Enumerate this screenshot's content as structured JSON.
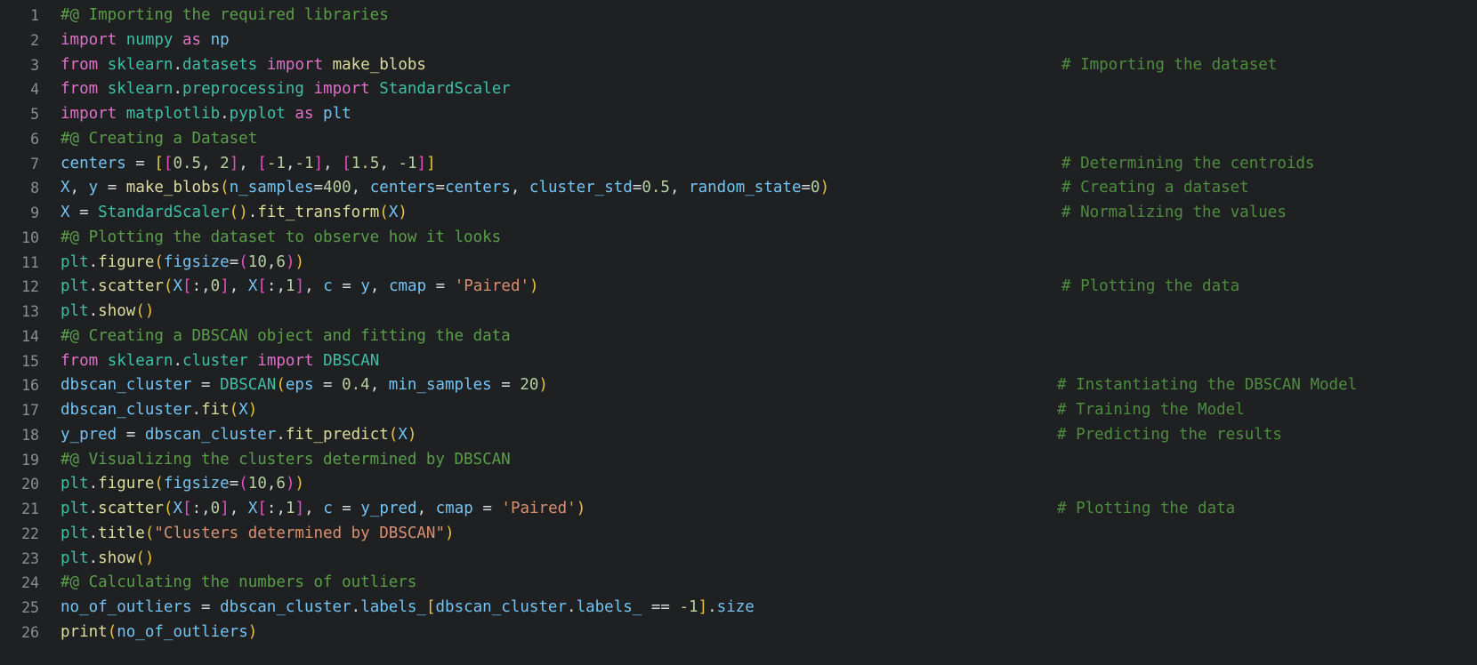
{
  "editor": {
    "language": "python",
    "theme": "dark",
    "background_color": "#1f2022",
    "gutter_color": "#8b8f93",
    "total_lines": 26,
    "first_visible_line": 1,
    "last_visible_line": 26
  },
  "colors": {
    "comment": "#5a9e4a",
    "keyword": "#e06fc8",
    "module": "#3fbfa8",
    "function": "#dcdc9d",
    "variable": "#73c3f3",
    "number": "#b6cfa0",
    "string": "#d79070",
    "operator": "#d8d8d8",
    "bracket_1": "#e6c341",
    "bracket_2": "#e44fc0",
    "bracket_3": "#35b7f0"
  },
  "line_numbers": [
    "1",
    "2",
    "3",
    "4",
    "5",
    "6",
    "7",
    "8",
    "9",
    "10",
    "11",
    "12",
    "13",
    "14",
    "15",
    "16",
    "17",
    "18",
    "19",
    "20",
    "21",
    "22",
    "23",
    "24",
    "25",
    "26"
  ],
  "lines": [
    {
      "n": "1",
      "text": "#@ Importing the required libraries",
      "trailing_comment": ""
    },
    {
      "n": "2",
      "text": "import numpy as np",
      "trailing_comment": ""
    },
    {
      "n": "3",
      "text": "from sklearn.datasets import make_blobs",
      "trailing_comment": "# Importing the dataset"
    },
    {
      "n": "4",
      "text": "from sklearn.preprocessing import StandardScaler",
      "trailing_comment": ""
    },
    {
      "n": "5",
      "text": "import matplotlib.pyplot as plt",
      "trailing_comment": ""
    },
    {
      "n": "6",
      "text": "#@ Creating a Dataset",
      "trailing_comment": ""
    },
    {
      "n": "7",
      "text": "centers = [[0.5, 2], [-1,-1], [1.5, -1]]",
      "trailing_comment": "# Determining the centroids"
    },
    {
      "n": "8",
      "text": "X, y = make_blobs(n_samples=400, centers=centers, cluster_std=0.5, random_state=0)",
      "trailing_comment": "# Creating a dataset"
    },
    {
      "n": "9",
      "text": "X = StandardScaler().fit_transform(X)",
      "trailing_comment": "# Normalizing the values"
    },
    {
      "n": "10",
      "text": "#@ Plotting the dataset to observe how it looks",
      "trailing_comment": ""
    },
    {
      "n": "11",
      "text": "plt.figure(figsize=(10,6))",
      "trailing_comment": ""
    },
    {
      "n": "12",
      "text": "plt.scatter(X[:,0], X[:,1], c = y, cmap = 'Paired')",
      "trailing_comment": "# Plotting the data"
    },
    {
      "n": "13",
      "text": "plt.show()",
      "trailing_comment": ""
    },
    {
      "n": "14",
      "text": "#@ Creating a DBSCAN object and fitting the data",
      "trailing_comment": ""
    },
    {
      "n": "15",
      "text": "from sklearn.cluster import DBSCAN",
      "trailing_comment": ""
    },
    {
      "n": "16",
      "text": "dbscan_cluster = DBSCAN(eps = 0.4, min_samples = 20)",
      "trailing_comment": "# Instantiating the DBSCAN Model"
    },
    {
      "n": "17",
      "text": "dbscan_cluster.fit(X)",
      "trailing_comment": "# Training the Model"
    },
    {
      "n": "18",
      "text": "y_pred = dbscan_cluster.fit_predict(X)",
      "trailing_comment": "# Predicting the results"
    },
    {
      "n": "19",
      "text": "#@ Visualizing the clusters determined by DBSCAN",
      "trailing_comment": ""
    },
    {
      "n": "20",
      "text": "plt.figure(figsize=(10,6))",
      "trailing_comment": ""
    },
    {
      "n": "21",
      "text": "plt.scatter(X[:,0], X[:,1], c = y_pred, cmap = 'Paired')",
      "trailing_comment": "# Plotting the data"
    },
    {
      "n": "22",
      "text": "plt.title(\"Clusters determined by DBSCAN\")",
      "trailing_comment": ""
    },
    {
      "n": "23",
      "text": "plt.show()",
      "trailing_comment": ""
    },
    {
      "n": "24",
      "text": "#@ Calculating the numbers of outliers",
      "trailing_comment": ""
    },
    {
      "n": "25",
      "text": "no_of_outliers = dbscan_cluster.labels_[dbscan_cluster.labels_ == -1].size",
      "trailing_comment": ""
    },
    {
      "n": "26",
      "text": "print(no_of_outliers)",
      "trailing_comment": ""
    }
  ],
  "tokens": {
    "l1": [
      [
        "#@ Importing the required libraries",
        "cmt"
      ]
    ],
    "l2": [
      [
        "import ",
        "kw"
      ],
      [
        "numpy",
        "mod"
      ],
      [
        " as ",
        "kw"
      ],
      [
        "np",
        "var"
      ]
    ],
    "l3": [
      [
        "from ",
        "kw"
      ],
      [
        "sklearn",
        "mod"
      ],
      [
        ".",
        "op"
      ],
      [
        "datasets",
        "mod"
      ],
      [
        " import ",
        "kw"
      ],
      [
        "make_blobs",
        "fn"
      ]
    ],
    "l4": [
      [
        "from ",
        "kw"
      ],
      [
        "sklearn",
        "mod"
      ],
      [
        ".",
        "op"
      ],
      [
        "preprocessing",
        "mod"
      ],
      [
        " import ",
        "kw"
      ],
      [
        "StandardScaler",
        "mod"
      ]
    ],
    "l5": [
      [
        "import ",
        "kw"
      ],
      [
        "matplotlib",
        "mod"
      ],
      [
        ".",
        "op"
      ],
      [
        "pyplot",
        "mod"
      ],
      [
        " as ",
        "kw"
      ],
      [
        "plt",
        "var"
      ]
    ],
    "l6": [
      [
        "#@ Creating a Dataset",
        "cmt"
      ]
    ],
    "l7": [
      [
        "centers",
        "var"
      ],
      [
        " = ",
        "op"
      ],
      [
        "[",
        "b1"
      ],
      [
        "[",
        "b2"
      ],
      [
        "0.5",
        "num"
      ],
      [
        ", ",
        "op"
      ],
      [
        "2",
        "num"
      ],
      [
        "]",
        "b2"
      ],
      [
        ", ",
        "op"
      ],
      [
        "[",
        "b2"
      ],
      [
        "-1",
        "num"
      ],
      [
        ",",
        "op"
      ],
      [
        "-1",
        "num"
      ],
      [
        "]",
        "b2"
      ],
      [
        ", ",
        "op"
      ],
      [
        "[",
        "b2"
      ],
      [
        "1.5",
        "num"
      ],
      [
        ", ",
        "op"
      ],
      [
        "-1",
        "num"
      ],
      [
        "]",
        "b2"
      ],
      [
        "]",
        "b1"
      ]
    ],
    "l8": [
      [
        "X",
        "var"
      ],
      [
        ", ",
        "op"
      ],
      [
        "y",
        "var"
      ],
      [
        " = ",
        "op"
      ],
      [
        "make_blobs",
        "fn"
      ],
      [
        "(",
        "b1"
      ],
      [
        "n_samples",
        "var"
      ],
      [
        "=",
        "op"
      ],
      [
        "400",
        "num"
      ],
      [
        ", ",
        "op"
      ],
      [
        "centers",
        "var"
      ],
      [
        "=",
        "op"
      ],
      [
        "centers",
        "var"
      ],
      [
        ", ",
        "op"
      ],
      [
        "cluster_std",
        "var"
      ],
      [
        "=",
        "op"
      ],
      [
        "0.5",
        "num"
      ],
      [
        ", ",
        "op"
      ],
      [
        "random_state",
        "var"
      ],
      [
        "=",
        "op"
      ],
      [
        "0",
        "num"
      ],
      [
        ")",
        "b1"
      ]
    ],
    "l9": [
      [
        "X",
        "var"
      ],
      [
        " = ",
        "op"
      ],
      [
        "StandardScaler",
        "mod"
      ],
      [
        "(",
        "b1"
      ],
      [
        ")",
        "b1"
      ],
      [
        ".",
        "op"
      ],
      [
        "fit_transform",
        "fn"
      ],
      [
        "(",
        "b1"
      ],
      [
        "X",
        "var"
      ],
      [
        ")",
        "b1"
      ]
    ],
    "l10": [
      [
        "#@ Plotting the dataset to observe how it looks",
        "cmt"
      ]
    ],
    "l11": [
      [
        "plt",
        "plt"
      ],
      [
        ".",
        "op"
      ],
      [
        "figure",
        "fn"
      ],
      [
        "(",
        "b1"
      ],
      [
        "figsize",
        "var"
      ],
      [
        "=",
        "op"
      ],
      [
        "(",
        "b2"
      ],
      [
        "10",
        "num"
      ],
      [
        ",",
        "op"
      ],
      [
        "6",
        "num"
      ],
      [
        ")",
        "b2"
      ],
      [
        ")",
        "b1"
      ]
    ],
    "l12": [
      [
        "plt",
        "plt"
      ],
      [
        ".",
        "op"
      ],
      [
        "scatter",
        "fn"
      ],
      [
        "(",
        "b1"
      ],
      [
        "X",
        "var"
      ],
      [
        "[",
        "b2"
      ],
      [
        ":",
        "op"
      ],
      [
        ",",
        "op"
      ],
      [
        "0",
        "num"
      ],
      [
        "]",
        "b2"
      ],
      [
        ", ",
        "op"
      ],
      [
        "X",
        "var"
      ],
      [
        "[",
        "b2"
      ],
      [
        ":",
        "op"
      ],
      [
        ",",
        "op"
      ],
      [
        "1",
        "num"
      ],
      [
        "]",
        "b2"
      ],
      [
        ", ",
        "op"
      ],
      [
        "c",
        "var"
      ],
      [
        " = ",
        "op"
      ],
      [
        "y",
        "var"
      ],
      [
        ", ",
        "op"
      ],
      [
        "cmap",
        "var"
      ],
      [
        " = ",
        "op"
      ],
      [
        "'Paired'",
        "str"
      ],
      [
        ")",
        "b1"
      ]
    ],
    "l13": [
      [
        "plt",
        "plt"
      ],
      [
        ".",
        "op"
      ],
      [
        "show",
        "fn"
      ],
      [
        "(",
        "b1"
      ],
      [
        ")",
        "b1"
      ]
    ],
    "l14": [
      [
        "#@ Creating a DBSCAN object and fitting the data",
        "cmt"
      ]
    ],
    "l15": [
      [
        "from ",
        "kw"
      ],
      [
        "sklearn",
        "mod"
      ],
      [
        ".",
        "op"
      ],
      [
        "cluster",
        "mod"
      ],
      [
        " import ",
        "kw"
      ],
      [
        "DBSCAN",
        "mod"
      ]
    ],
    "l16": [
      [
        "dbscan_cluster",
        "var"
      ],
      [
        " = ",
        "op"
      ],
      [
        "DBSCAN",
        "mod"
      ],
      [
        "(",
        "b1"
      ],
      [
        "eps",
        "var"
      ],
      [
        " = ",
        "op"
      ],
      [
        "0.4",
        "num"
      ],
      [
        ", ",
        "op"
      ],
      [
        "min_samples",
        "var"
      ],
      [
        " = ",
        "op"
      ],
      [
        "20",
        "num"
      ],
      [
        ")",
        "b1"
      ]
    ],
    "l17": [
      [
        "dbscan_cluster",
        "var"
      ],
      [
        ".",
        "op"
      ],
      [
        "fit",
        "fn"
      ],
      [
        "(",
        "b1"
      ],
      [
        "X",
        "var"
      ],
      [
        ")",
        "b1"
      ]
    ],
    "l18": [
      [
        "y_pred",
        "var"
      ],
      [
        " = ",
        "op"
      ],
      [
        "dbscan_cluster",
        "var"
      ],
      [
        ".",
        "op"
      ],
      [
        "fit_predict",
        "fn"
      ],
      [
        "(",
        "b1"
      ],
      [
        "X",
        "var"
      ],
      [
        ")",
        "b1"
      ]
    ],
    "l19": [
      [
        "#@ Visualizing the clusters determined by DBSCAN",
        "cmt"
      ]
    ],
    "l20": [
      [
        "plt",
        "plt"
      ],
      [
        ".",
        "op"
      ],
      [
        "figure",
        "fn"
      ],
      [
        "(",
        "b1"
      ],
      [
        "figsize",
        "var"
      ],
      [
        "=",
        "op"
      ],
      [
        "(",
        "b2"
      ],
      [
        "10",
        "num"
      ],
      [
        ",",
        "op"
      ],
      [
        "6",
        "num"
      ],
      [
        ")",
        "b2"
      ],
      [
        ")",
        "b1"
      ]
    ],
    "l21": [
      [
        "plt",
        "plt"
      ],
      [
        ".",
        "op"
      ],
      [
        "scatter",
        "fn"
      ],
      [
        "(",
        "b1"
      ],
      [
        "X",
        "var"
      ],
      [
        "[",
        "b2"
      ],
      [
        ":",
        "op"
      ],
      [
        ",",
        "op"
      ],
      [
        "0",
        "num"
      ],
      [
        "]",
        "b2"
      ],
      [
        ", ",
        "op"
      ],
      [
        "X",
        "var"
      ],
      [
        "[",
        "b2"
      ],
      [
        ":",
        "op"
      ],
      [
        ",",
        "op"
      ],
      [
        "1",
        "num"
      ],
      [
        "]",
        "b2"
      ],
      [
        ", ",
        "op"
      ],
      [
        "c",
        "var"
      ],
      [
        " = ",
        "op"
      ],
      [
        "y_pred",
        "var"
      ],
      [
        ", ",
        "op"
      ],
      [
        "cmap",
        "var"
      ],
      [
        " = ",
        "op"
      ],
      [
        "'Paired'",
        "str"
      ],
      [
        ")",
        "b1"
      ]
    ],
    "l22": [
      [
        "plt",
        "plt"
      ],
      [
        ".",
        "op"
      ],
      [
        "title",
        "fn"
      ],
      [
        "(",
        "b1"
      ],
      [
        "\"Clusters determined by DBSCAN\"",
        "str"
      ],
      [
        ")",
        "b1"
      ]
    ],
    "l23": [
      [
        "plt",
        "plt"
      ],
      [
        ".",
        "op"
      ],
      [
        "show",
        "fn"
      ],
      [
        "(",
        "b1"
      ],
      [
        ")",
        "b1"
      ]
    ],
    "l24": [
      [
        "#@ Calculating the numbers of outliers",
        "cmt"
      ]
    ],
    "l25": [
      [
        "no_of_outliers",
        "var"
      ],
      [
        " = ",
        "op"
      ],
      [
        "dbscan_cluster",
        "var"
      ],
      [
        ".",
        "op"
      ],
      [
        "labels_",
        "var"
      ],
      [
        "[",
        "b1"
      ],
      [
        "dbscan_cluster",
        "var"
      ],
      [
        ".",
        "op"
      ],
      [
        "labels_",
        "var"
      ],
      [
        " == ",
        "op"
      ],
      [
        "-1",
        "num"
      ],
      [
        "]",
        "b1"
      ],
      [
        ".",
        "op"
      ],
      [
        "size",
        "var"
      ]
    ],
    "l26": [
      [
        "print",
        "fn"
      ],
      [
        "(",
        "b1"
      ],
      [
        "no_of_outliers",
        "var"
      ],
      [
        ")",
        "b1"
      ]
    ]
  },
  "trailing_comments": {
    "l3": {
      "text": "# Importing the dataset",
      "col": "a"
    },
    "l7": {
      "text": "# Determining the centroids",
      "col": "a"
    },
    "l8": {
      "text": "# Creating a dataset",
      "col": "a"
    },
    "l9": {
      "text": "# Normalizing the values",
      "col": "a"
    },
    "l12": {
      "text": "# Plotting the data",
      "col": "a"
    },
    "l16": {
      "text": "# Instantiating the DBSCAN Model",
      "col": "b"
    },
    "l17": {
      "text": "# Training the Model",
      "col": "b"
    },
    "l18": {
      "text": "# Predicting the results",
      "col": "b"
    },
    "l21": {
      "text": "# Plotting the data",
      "col": "b"
    }
  }
}
